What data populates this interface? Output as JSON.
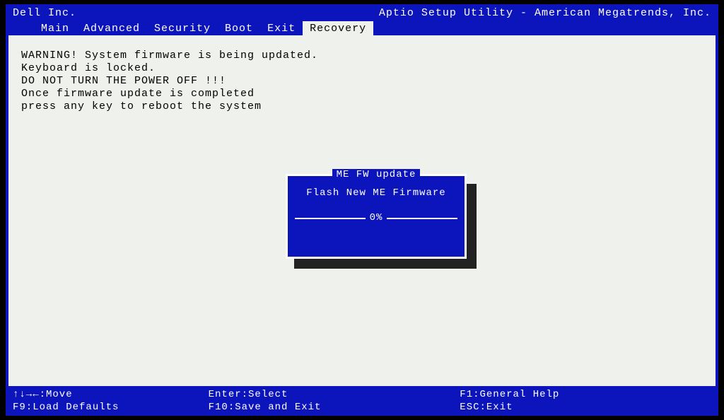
{
  "brand": "Dell Inc.",
  "utility_title": "Aptio Setup Utility - American Megatrends, Inc.",
  "menu": {
    "items": [
      {
        "label": "Main",
        "active": false
      },
      {
        "label": "Advanced",
        "active": false
      },
      {
        "label": "Security",
        "active": false
      },
      {
        "label": "Boot",
        "active": false
      },
      {
        "label": "Exit",
        "active": false
      },
      {
        "label": "Recovery",
        "active": true
      }
    ]
  },
  "warning": {
    "line1": "WARNING! System firmware is being updated.",
    "line2": "Keyboard is locked.",
    "line3": "DO NOT TURN THE POWER OFF !!!",
    "line4": "Once firmware update is completed",
    "line5": "press any key to reboot the system"
  },
  "dialog": {
    "title": "ME FW update",
    "body": "Flash New ME Firmware",
    "progress_text": "0%"
  },
  "footer": {
    "r1c1": "↑↓→←:Move",
    "r1c2": "Enter:Select",
    "r1c3": "F1:General Help",
    "r2c1": "F9:Load Defaults",
    "r2c2": "F10:Save and Exit",
    "r2c3": "ESC:Exit"
  }
}
